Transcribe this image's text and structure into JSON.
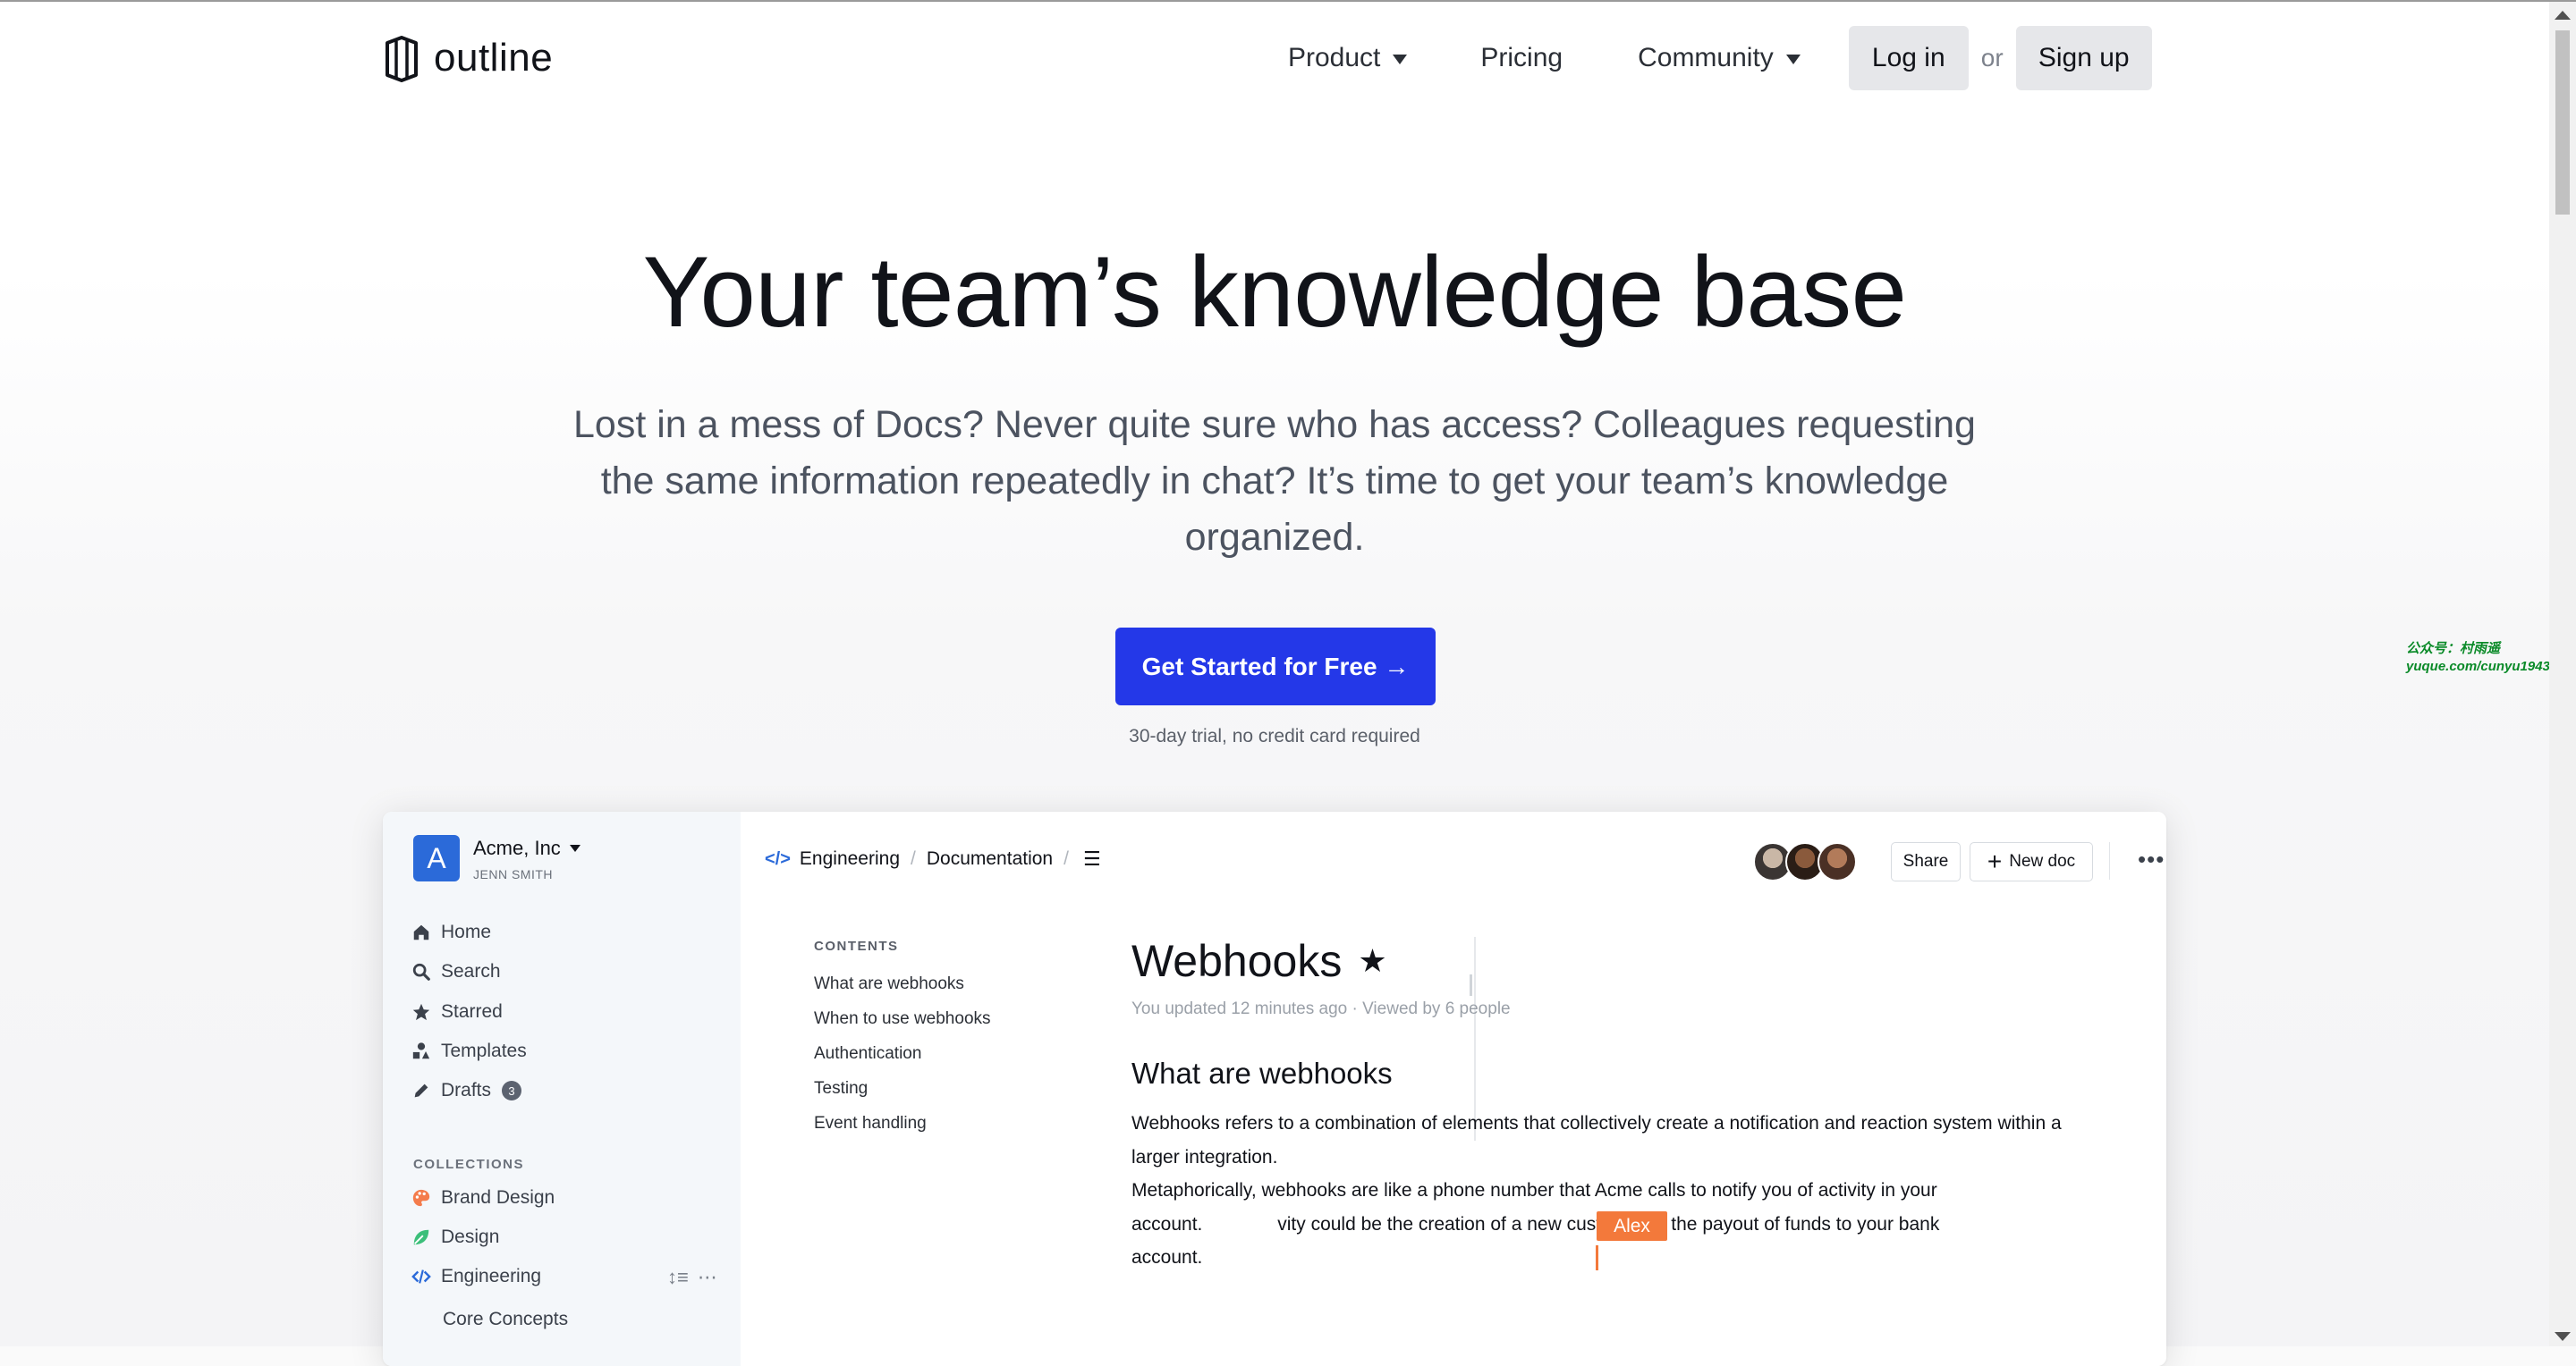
{
  "header": {
    "logo_text": "outline",
    "nav": [
      {
        "label": "Product",
        "has_dropdown": true
      },
      {
        "label": "Pricing",
        "has_dropdown": false
      },
      {
        "label": "Community",
        "has_dropdown": true
      }
    ],
    "login_label": "Log in",
    "or_label": "or",
    "signup_label": "Sign up"
  },
  "hero": {
    "title": "Your team’s knowledge base",
    "subtitle": "Lost in a mess of Docs? Never quite sure who has access? Colleagues requesting the same information repeatedly in chat? It’s time to get your team’s knowledge organized.",
    "cta_label": "Get Started for Free →",
    "trial_note": "30-day trial, no credit card required"
  },
  "watermark": {
    "line1": "公众号：村雨遥",
    "line2": "yuque.com/cunyu1943"
  },
  "app": {
    "workspace": {
      "avatar_letter": "A",
      "name": "Acme, Inc",
      "user": "JENN SMITH"
    },
    "sidebar": {
      "items": [
        {
          "label": "Home",
          "icon": "home-icon"
        },
        {
          "label": "Search",
          "icon": "search-icon"
        },
        {
          "label": "Starred",
          "icon": "star-icon"
        },
        {
          "label": "Templates",
          "icon": "shapes-icon"
        },
        {
          "label": "Drafts",
          "icon": "pencil-icon",
          "badge": "3"
        }
      ],
      "collections_heading": "COLLECTIONS",
      "collections": [
        {
          "label": "Brand Design",
          "icon": "palette-icon",
          "color": "#f47c4c"
        },
        {
          "label": "Design",
          "icon": "leaf-icon",
          "color": "#3cbf7a"
        },
        {
          "label": "Engineering",
          "icon": "code-icon",
          "color": "#2b6ad9"
        }
      ],
      "sub_items": [
        {
          "label": "Core Concepts"
        }
      ]
    },
    "breadcrumb": {
      "collection": "Engineering",
      "document": "Documentation"
    },
    "toolbar": {
      "share_label": "Share",
      "new_doc_label": "New doc"
    },
    "toc": {
      "heading": "CONTENTS",
      "items": [
        "What are webhooks",
        "When to use webhooks",
        "Authentication",
        "Testing",
        "Event handling"
      ]
    },
    "document": {
      "title": "Webhooks",
      "meta": "You updated 12 minutes ago · Viewed by 6 people",
      "heading": "What are webhooks",
      "para1": "Webhooks refers to a combination of elements that collectively create a notification and reaction system within a larger integration.",
      "para2_line1": "Metaphorically, webhooks are like a phone number that Acme calls to notify you of activity in your",
      "para2_line2a": "account.",
      "para2_line2b": "vity could be the creation of a new customer or the payout of funds to your bank",
      "para2_line3": "account.",
      "cursor_name": "Alex"
    }
  },
  "colors": {
    "cta": "#2438e8",
    "cursor": "#f3793b",
    "workspace_avatar": "#2b6ad9"
  }
}
